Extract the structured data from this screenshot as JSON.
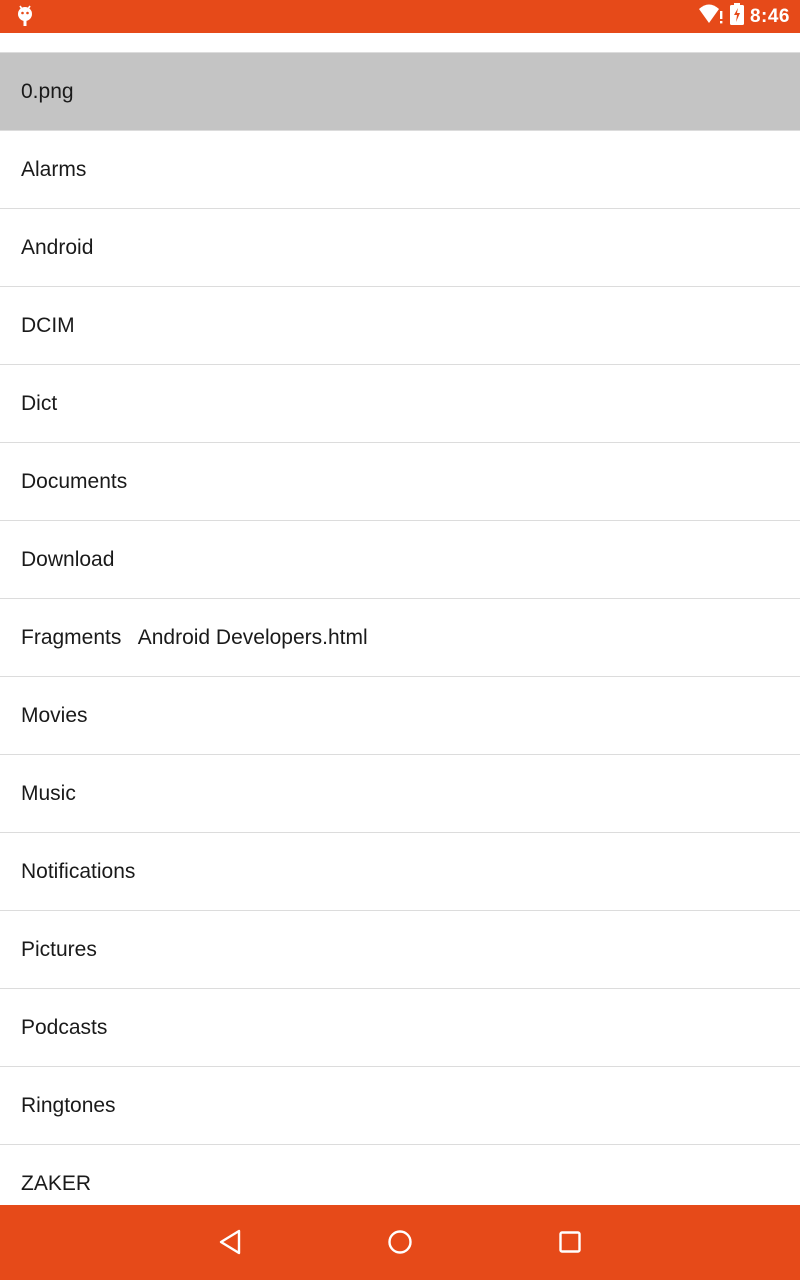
{
  "status_bar": {
    "time": "8:46",
    "left_icon": "android-debug-icon",
    "wifi_icon": "wifi-alert-icon",
    "battery_icon": "battery-charging-icon"
  },
  "file_list": {
    "items": [
      {
        "label": "0.png",
        "selected": true
      },
      {
        "label": "Alarms",
        "selected": false
      },
      {
        "label": "Android",
        "selected": false
      },
      {
        "label": "DCIM",
        "selected": false
      },
      {
        "label": "Dict",
        "selected": false
      },
      {
        "label": "Documents",
        "selected": false
      },
      {
        "label": "Download",
        "selected": false
      },
      {
        "label": "Fragments   Android Developers.html",
        "selected": false
      },
      {
        "label": "Movies",
        "selected": false
      },
      {
        "label": "Music",
        "selected": false
      },
      {
        "label": "Notifications",
        "selected": false
      },
      {
        "label": "Pictures",
        "selected": false
      },
      {
        "label": "Podcasts",
        "selected": false
      },
      {
        "label": "Ringtones",
        "selected": false
      },
      {
        "label": "ZAKER",
        "selected": false
      }
    ]
  },
  "nav_bar": {
    "back_icon": "back-triangle-icon",
    "home_icon": "home-circle-icon",
    "recents_icon": "recents-square-icon"
  },
  "colors": {
    "accent": "#e64a19",
    "selected_row": "#c4c4c4",
    "divider": "#dcdcdc",
    "text": "#1a1a1a"
  }
}
